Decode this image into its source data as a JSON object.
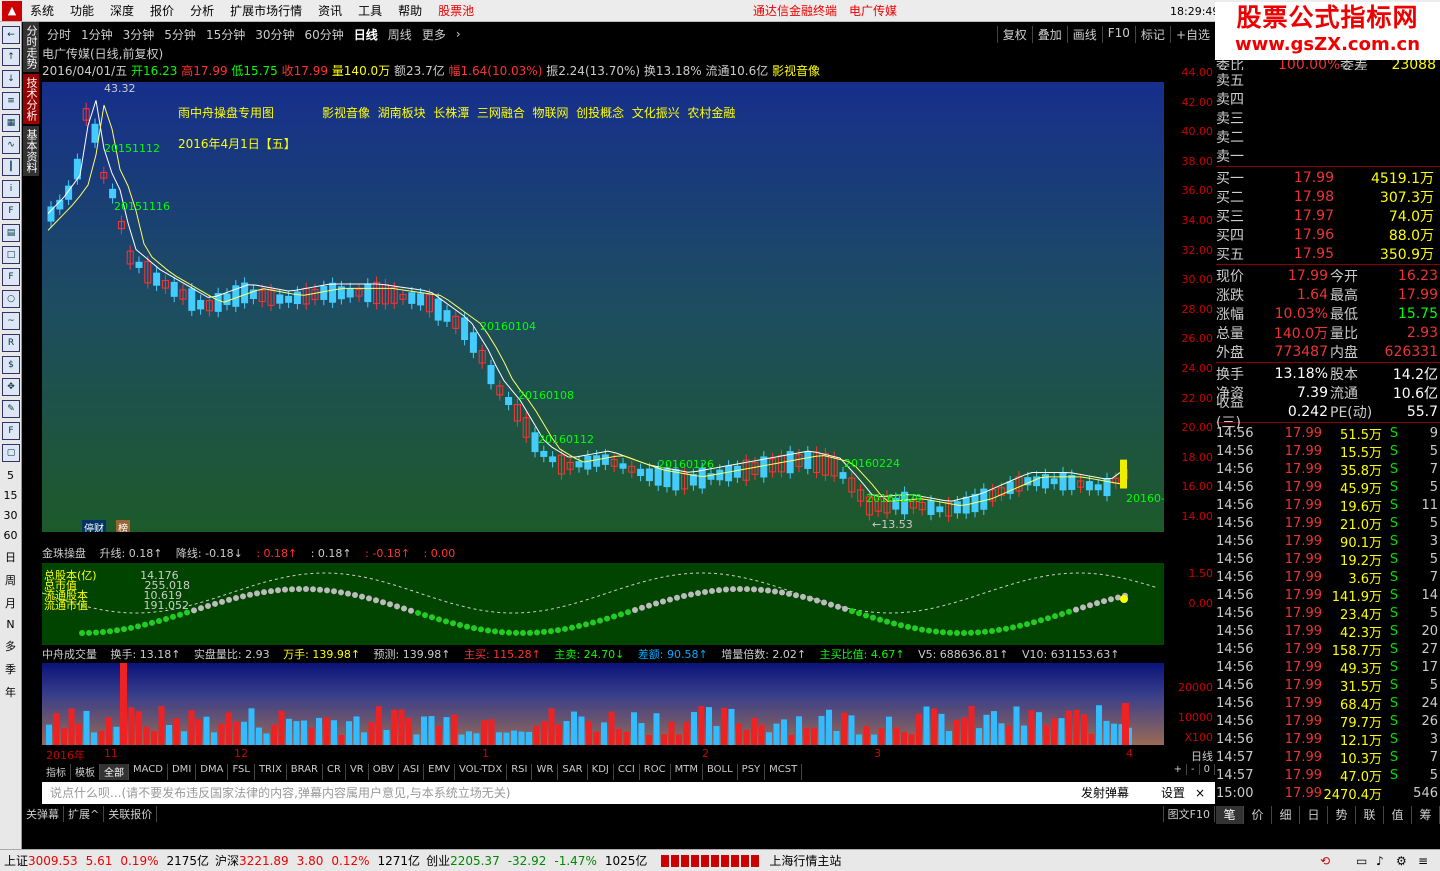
{
  "menu": {
    "items": [
      "系统",
      "功能",
      "深度",
      "报价",
      "分析",
      "扩展市场行情",
      "资讯",
      "工具",
      "帮助"
    ],
    "pool": "股票池",
    "center": "通达信金融终端　电广传媒",
    "time": "18:29:49 周五"
  },
  "brand": {
    "line1": "股票公式指标网",
    "line2": "www.gsZX.com.cn"
  },
  "toolbar": {
    "periods": [
      "分时",
      "1分钟",
      "3分钟",
      "5分钟",
      "15分钟",
      "30分钟",
      "60分钟",
      "日线",
      "周线",
      "更多"
    ],
    "active": "日线",
    "right": [
      "复权",
      "叠加",
      "画线",
      "F10",
      "标记",
      "+自选"
    ]
  },
  "vtabs": [
    "分时走势",
    "技术分析",
    "基本资料"
  ],
  "leftnums": [
    "5",
    "15",
    "30",
    "60",
    "日",
    "周",
    "月",
    "N",
    "多",
    "季",
    "年"
  ],
  "header": {
    "line1": "电广传媒(日线,前复权)",
    "line2a": "2016/04/01/五",
    "open": "开16.23",
    "high": "高17.99",
    "low": "低15.75",
    "close": "收17.99",
    "vol": "量140.0万",
    "amt": "额23.7亿",
    "pct": "幅1.64(10.03%)",
    "amp": "振2.24(13.70%)",
    "turn": "换13.18%",
    "float": "流通10.6亿",
    "sector": "影视音像"
  },
  "main": {
    "title": "雨中舟操盘专用图",
    "tags": "影视音像  湖南板块  长株潭  三网融合  物联网  创投概念  文化振兴  农村金融",
    "date": "2016年4月1日【五】",
    "high_label": "43.32",
    "low_label": "←13.53",
    "labels": [
      "20151112",
      "20151116",
      "20160104",
      "20160108",
      "20160112",
      "20160126",
      "20160224",
      "20160229",
      "20160-"
    ],
    "badges": [
      "停财",
      "榜"
    ]
  },
  "price_axis": [
    "44.00",
    "42.00",
    "40.00",
    "38.00",
    "36.00",
    "34.00",
    "32.00",
    "30.00",
    "28.00",
    "26.00",
    "24.00",
    "22.00",
    "20.00",
    "18.00",
    "16.00",
    "14.00"
  ],
  "ind1": {
    "name": "金珠操盘",
    "up": "升线: 0.18↑",
    "down": "降线: -0.18↓",
    "v1": ": 0.18↑",
    "v2": ": 0.18↑",
    "v3": ": -0.18↑",
    "v4": ": 0.00",
    "lines": [
      "总股本(亿)",
      "总市值",
      "流通股本",
      "流通市值"
    ],
    "vals": [
      "14.176",
      "255.018",
      "10.619",
      "191.052"
    ],
    "axis": [
      "1.50",
      "0.00"
    ]
  },
  "ind2": {
    "name": "中舟成交量",
    "items": [
      "换手: 13.18↑",
      "实盘量比: 2.93",
      "万手: 139.98↑",
      "预测: 139.98↑",
      "主买: 115.28↑",
      "主卖: 24.70↓",
      "差额: 90.58↑",
      "增量倍数: 2.02↑",
      "主买比值: 4.67↑",
      "V5: 688636.81↑",
      "V10: 631153.63↑"
    ],
    "axis": [
      "20000",
      "10000",
      "X100"
    ],
    "months": [
      "2016年",
      "11",
      "12",
      "1",
      "2",
      "3",
      "4"
    ],
    "axis_label": "日线"
  },
  "tabs": [
    "指标",
    "模板",
    "全部",
    "MACD",
    "DMI",
    "DMA",
    "FSL",
    "TRIX",
    "BRAR",
    "CR",
    "VR",
    "OBV",
    "ASI",
    "EMV",
    "VOL-TDX",
    "RSI",
    "WR",
    "SAR",
    "KDJ",
    "CCI",
    "ROC",
    "MTM",
    "BOLL",
    "PSY",
    "MCST"
  ],
  "tabs_right": [
    "+",
    "-",
    "0"
  ],
  "chat": {
    "placeholder": "说点什么呗...(请不要发布违反国家法律的内容,弹幕内容属用户意见,与本系统立场无关)",
    "send": "发射弹幕",
    "settings": "设置",
    "close": "×"
  },
  "bottom": [
    "关弹幕",
    "扩展^",
    "关联报价"
  ],
  "bottom_right": "图文F10",
  "quote": {
    "top": {
      "l": "委比",
      "p": "100.00%",
      "k": "委差",
      "v": "23088"
    },
    "sells": [
      "卖五",
      "卖四",
      "卖三",
      "卖二",
      "卖一"
    ],
    "buys": [
      {
        "l": "买一",
        "p": "17.99",
        "v": "4519.1万"
      },
      {
        "l": "买二",
        "p": "17.98",
        "v": "307.3万"
      },
      {
        "l": "买三",
        "p": "17.97",
        "v": "74.0万"
      },
      {
        "l": "买四",
        "p": "17.96",
        "v": "88.0万"
      },
      {
        "l": "买五",
        "p": "17.95",
        "v": "350.9万"
      }
    ],
    "stats": [
      [
        "现价",
        "17.99",
        "今开",
        "16.23"
      ],
      [
        "涨跌",
        "1.64",
        "最高",
        "17.99"
      ],
      [
        "涨幅",
        "10.03%",
        "最低",
        "15.75"
      ],
      [
        "总量",
        "140.0万",
        "量比",
        "2.93"
      ],
      [
        "外盘",
        "773487",
        "内盘",
        "626331"
      ]
    ],
    "stats2": [
      [
        "换手",
        "13.18%",
        "股本",
        "14.2亿"
      ],
      [
        "净资",
        "7.39",
        "流通",
        "10.6亿"
      ],
      [
        "收益(三)",
        "0.242",
        "PE(动)",
        "55.7"
      ]
    ],
    "ticks": [
      [
        "14:56",
        "17.99",
        "51.5万",
        "S",
        "9"
      ],
      [
        "14:56",
        "17.99",
        "15.5万",
        "S",
        "5"
      ],
      [
        "14:56",
        "17.99",
        "35.8万",
        "S",
        "7"
      ],
      [
        "14:56",
        "17.99",
        "45.9万",
        "S",
        "5"
      ],
      [
        "14:56",
        "17.99",
        "19.6万",
        "S",
        "11"
      ],
      [
        "14:56",
        "17.99",
        "21.0万",
        "S",
        "5"
      ],
      [
        "14:56",
        "17.99",
        "90.1万",
        "S",
        "3"
      ],
      [
        "14:56",
        "17.99",
        "19.2万",
        "S",
        "5"
      ],
      [
        "14:56",
        "17.99",
        "3.6万",
        "S",
        "7"
      ],
      [
        "14:56",
        "17.99",
        "141.9万",
        "S",
        "14"
      ],
      [
        "14:56",
        "17.99",
        "23.4万",
        "S",
        "5"
      ],
      [
        "14:56",
        "17.99",
        "42.3万",
        "S",
        "20"
      ],
      [
        "14:56",
        "17.99",
        "158.7万",
        "S",
        "27"
      ],
      [
        "14:56",
        "17.99",
        "49.3万",
        "S",
        "17"
      ],
      [
        "14:56",
        "17.99",
        "31.5万",
        "S",
        "5"
      ],
      [
        "14:56",
        "17.99",
        "68.4万",
        "S",
        "24"
      ],
      [
        "14:56",
        "17.99",
        "79.7万",
        "S",
        "26"
      ],
      [
        "14:56",
        "17.99",
        "12.1万",
        "S",
        "3"
      ],
      [
        "14:57",
        "17.99",
        "10.3万",
        "S",
        "7"
      ],
      [
        "14:57",
        "17.99",
        "47.0万",
        "S",
        "5"
      ],
      [
        "15:00",
        "17.99",
        "2470.4万",
        "",
        "546"
      ]
    ]
  },
  "rtabs": [
    "笔",
    "价",
    "细",
    "日",
    "势",
    "联",
    "值",
    "筹"
  ],
  "status": {
    "sh": "上证",
    "sh_p": "3009.53",
    "sh_c": "5.61",
    "sh_pct": "0.19%",
    "sh_amt": "2175亿",
    "hs": "沪深",
    "hs_p": "3221.89",
    "hs_c": "3.80",
    "hs_pct": "0.12%",
    "hs_amt": "1271亿",
    "cy": "创业",
    "cy_p": "2205.37",
    "cy_c": "-32.92",
    "cy_pct": "-1.47%",
    "cy_amt": "1025亿",
    "station": "上海行情主站"
  }
}
